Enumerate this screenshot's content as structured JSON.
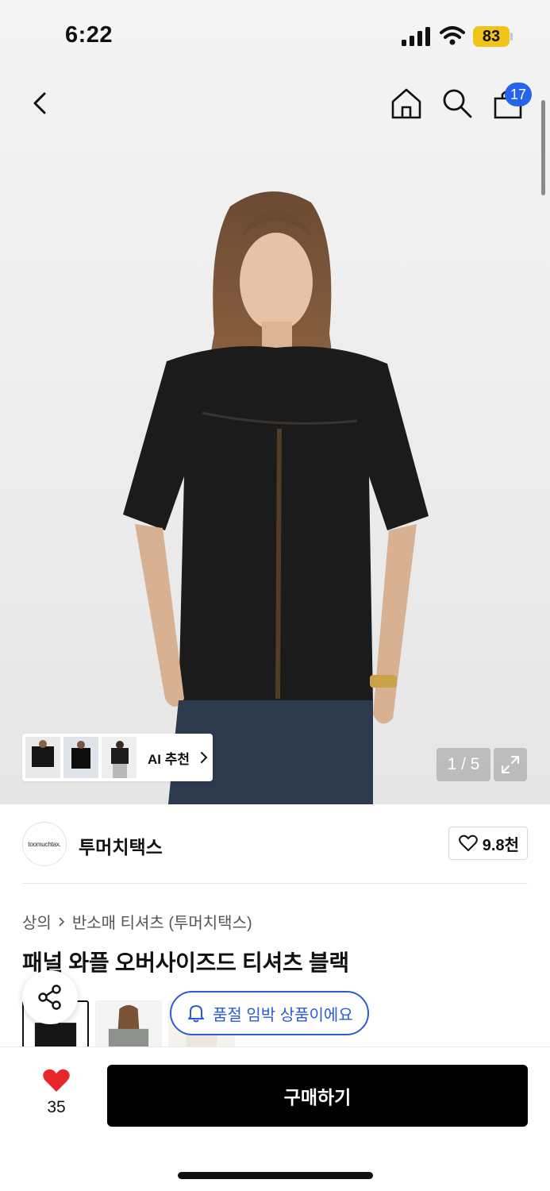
{
  "status_bar": {
    "time": "6:22",
    "battery": "83"
  },
  "nav": {
    "cart_count": "17"
  },
  "gallery": {
    "ai_label": "AI 추천",
    "counter": "1 / 5"
  },
  "brand": {
    "logo_text": "toomuchtax.",
    "name": "투머치택스",
    "likes": "9.8천"
  },
  "breadcrumb": {
    "category": "상의",
    "subcategory": "반소매 티셔츠 (투머치택스)"
  },
  "product": {
    "title": "패널 와플 오버사이즈드 티셔츠 블랙"
  },
  "notice": {
    "soldout_label": "품절 임박 상품이에요"
  },
  "bottom": {
    "wish_count": "35",
    "buy_label": "구매하기"
  },
  "colors": {
    "accent": "#2563eb",
    "notice_blue": "#2a5bd7",
    "heart": "#e8262b",
    "battery": "#f2c318"
  }
}
